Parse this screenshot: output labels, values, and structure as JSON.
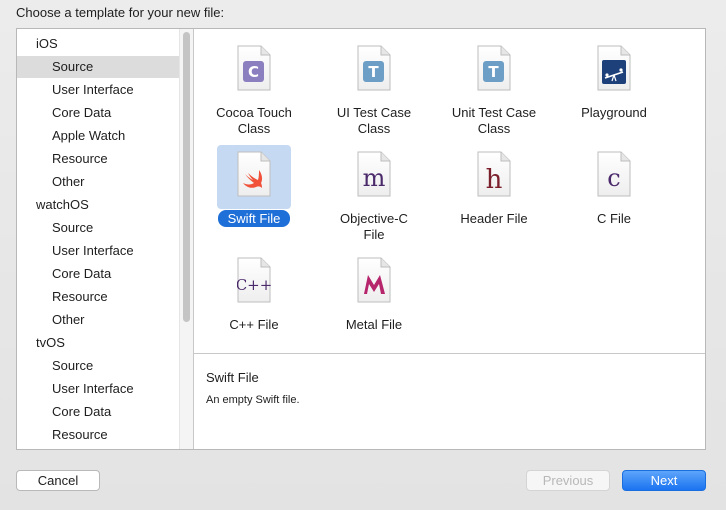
{
  "header": {
    "title": "Choose a template for your new file:"
  },
  "sidebar": {
    "rows": [
      {
        "label": "iOS",
        "kind": "group"
      },
      {
        "label": "Source",
        "kind": "item",
        "selected": true
      },
      {
        "label": "User Interface",
        "kind": "item"
      },
      {
        "label": "Core Data",
        "kind": "item"
      },
      {
        "label": "Apple Watch",
        "kind": "item"
      },
      {
        "label": "Resource",
        "kind": "item"
      },
      {
        "label": "Other",
        "kind": "item"
      },
      {
        "label": "watchOS",
        "kind": "group"
      },
      {
        "label": "Source",
        "kind": "item"
      },
      {
        "label": "User Interface",
        "kind": "item"
      },
      {
        "label": "Core Data",
        "kind": "item"
      },
      {
        "label": "Resource",
        "kind": "item"
      },
      {
        "label": "Other",
        "kind": "item"
      },
      {
        "label": "tvOS",
        "kind": "group"
      },
      {
        "label": "Source",
        "kind": "item"
      },
      {
        "label": "User Interface",
        "kind": "item"
      },
      {
        "label": "Core Data",
        "kind": "item"
      },
      {
        "label": "Resource",
        "kind": "item"
      }
    ]
  },
  "templates": [
    {
      "label": "Cocoa Touch Class",
      "glyph": "C",
      "icon": "cocoa-touch-class-icon",
      "selected": false
    },
    {
      "label": "UI Test Case Class",
      "glyph": "T",
      "icon": "ui-test-case-class-icon",
      "selected": false
    },
    {
      "label": "Unit Test Case Class",
      "glyph": "T",
      "icon": "unit-test-case-class-icon",
      "selected": false
    },
    {
      "label": "Playground",
      "glyph": "",
      "icon": "playground-icon",
      "selected": false
    },
    {
      "label": "Swift File",
      "glyph": "",
      "icon": "swift-file-icon",
      "selected": true
    },
    {
      "label": "Objective-C File",
      "glyph": "m",
      "icon": "objective-c-file-icon",
      "selected": false
    },
    {
      "label": "Header File",
      "glyph": "h",
      "icon": "header-file-icon",
      "selected": false
    },
    {
      "label": "C File",
      "glyph": "c",
      "icon": "c-file-icon",
      "selected": false
    },
    {
      "label": "C++ File",
      "glyph": "C++",
      "icon": "cpp-file-icon",
      "selected": false
    },
    {
      "label": "Metal File",
      "glyph": "",
      "icon": "metal-file-icon",
      "selected": false
    }
  ],
  "description": {
    "title": "Swift File",
    "text": "An empty Swift file."
  },
  "buttons": {
    "cancel": "Cancel",
    "previous": "Previous",
    "next": "Next"
  },
  "colors": {
    "selection_blue": "#1f6fd8",
    "selection_bg": "#c6d9f2",
    "sidebar_selected": "#dcdcdc",
    "class_badge_purple": "#8c7fc0",
    "test_badge_blue": "#6d9fc6",
    "swift_orange": "#f05138",
    "objc_purple": "#4b2a6b",
    "header_maroon": "#7a1f2b",
    "metal_magenta": "#b6246c"
  }
}
